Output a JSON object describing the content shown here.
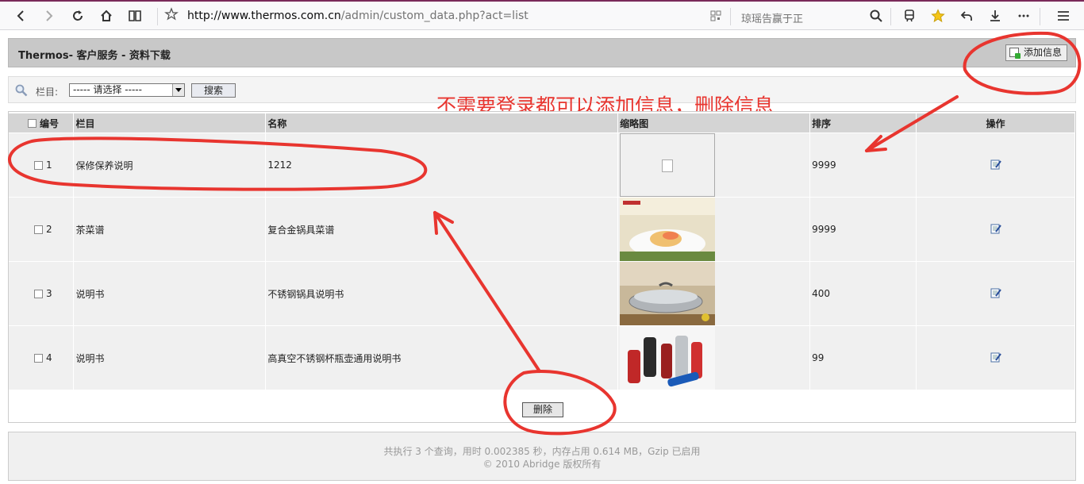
{
  "browser": {
    "url_host": "http://www.thermos.com.cn",
    "url_path": "/admin/custom_data.php?act=list",
    "search_text": "琼瑶告赢于正"
  },
  "header": {
    "title": "Thermos- 客户服务 - 资料下载",
    "add_button": "添加信息"
  },
  "search": {
    "label": "栏目:",
    "select_value": "----- 请选择 -----",
    "button": "搜索"
  },
  "annotation": "不需要登录都可以添加信息，删除信息",
  "table": {
    "headers": [
      "编号",
      "栏目",
      "名称",
      "缩略图",
      "排序",
      "操作"
    ],
    "rows": [
      {
        "id": "1",
        "category": "保修保养说明",
        "name": "1212",
        "sort": "9999"
      },
      {
        "id": "2",
        "category": "茶菜谱",
        "name": "复合金锅具菜谱",
        "sort": "9999"
      },
      {
        "id": "3",
        "category": "说明书",
        "name": "不锈钢锅具说明书",
        "sort": "400"
      },
      {
        "id": "4",
        "category": "说明书",
        "name": "高真空不锈钢杯瓶壶通用说明书",
        "sort": "99"
      }
    ],
    "delete_button": "删除"
  },
  "footer": {
    "line1": "共执行 3 个查询，用时 0.002385 秒，内存占用 0.614 MB，Gzip 已启用",
    "line2": "© 2010 Abridge 版权所有"
  },
  "colors": {
    "annotation_red": "#e8352f",
    "header_bg": "#c8c8c8",
    "row_bg": "#f0f0f0"
  }
}
